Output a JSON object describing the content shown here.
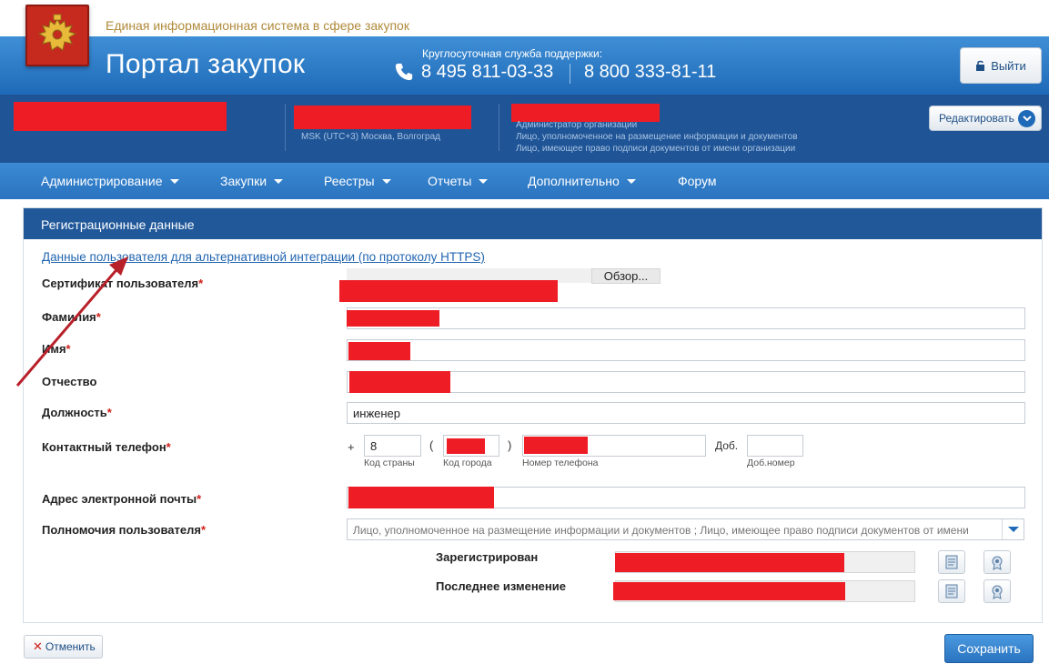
{
  "header": {
    "system_name": "Единая информационная система в сфере закупок",
    "portal_title": "Портал закупок",
    "support_label": "Круглосуточная служба поддержки:",
    "phone_1": "8 495 811-03-33",
    "phone_2": "8 800 333-81-11",
    "logout_label": "Выйти",
    "emblem_icon": "coat-of-arms-emblem"
  },
  "user_bar": {
    "timezone": "MSK (UTC+3) Москва, Волгоград",
    "roles": [
      "Администратор организации",
      "Лицо, уполномоченное на размещение информации и документов",
      "Лицо, имеющее право подписи документов от имени организации"
    ],
    "edit_label": "Редактировать"
  },
  "nav": {
    "items": [
      {
        "label": "Администрирование",
        "has_dropdown": true
      },
      {
        "label": "Закупки",
        "has_dropdown": true
      },
      {
        "label": "Реестры",
        "has_dropdown": true
      },
      {
        "label": "Отчеты",
        "has_dropdown": true
      },
      {
        "label": "Дополнительно",
        "has_dropdown": true
      },
      {
        "label": "Форум",
        "has_dropdown": false
      }
    ]
  },
  "panel": {
    "title": "Регистрационные данные",
    "alt_link": "Данные пользователя для альтернативной интеграции (по протоколу HTTPS)",
    "fields": {
      "certificate": {
        "label": "Сертификат пользователя",
        "browse_label": "Обзор..."
      },
      "last_name": {
        "label": "Фамилия"
      },
      "first_name": {
        "label": "Имя"
      },
      "patronymic": {
        "label": "Отчество"
      },
      "position": {
        "label": "Должность",
        "value": "инженер"
      },
      "phone": {
        "label": "Контактный телефон",
        "plus": "+",
        "country_code": "8",
        "open_paren": "(",
        "close_paren": ")",
        "ext_label": "Доб.",
        "country_code_label": "Код страны",
        "city_code_label": "Код города",
        "number_label": "Номер телефона",
        "ext_sublabel": "Доб.номер"
      },
      "email": {
        "label": "Адрес электронной почты"
      },
      "permissions": {
        "label": "Полномочия пользователя",
        "value": "Лицо, уполномоченное на размещение информации и документов ; Лицо, имеющее право подписи документов от имени"
      }
    },
    "registered_label": "Зарегистрирован",
    "last_change_label": "Последнее изменение",
    "required_mark": "*"
  },
  "footer": {
    "cancel_label": "Отменить",
    "save_label": "Сохранить"
  },
  "colors": {
    "header_blue": "#2a73bf",
    "userbar_blue": "#1f5597",
    "redaction_red": "#ee1c25",
    "annotation_arrow": "#b8202a"
  }
}
